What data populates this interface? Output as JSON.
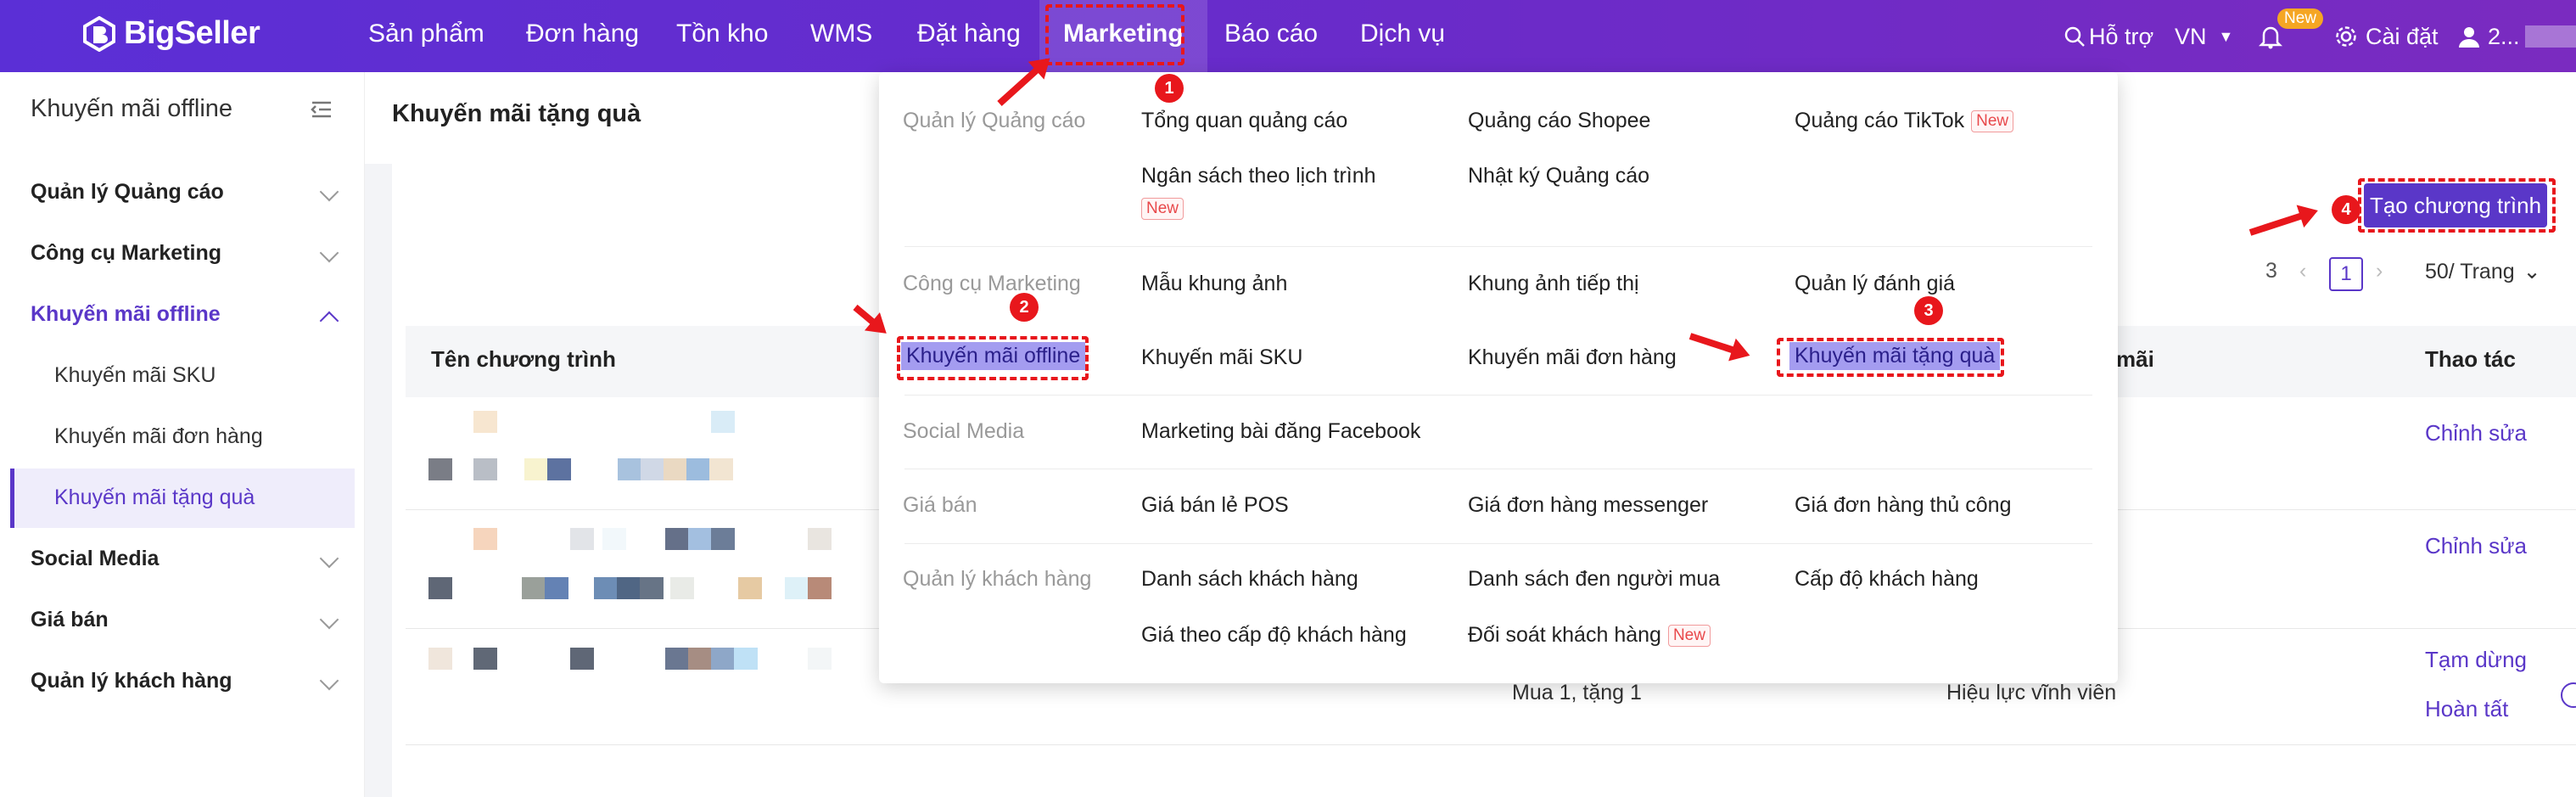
{
  "app": {
    "brand": "BigSeller"
  },
  "topnav": {
    "items": [
      "Sản phẩm",
      "Đơn hàng",
      "Tồn kho",
      "WMS",
      "Đặt hàng",
      "Marketing",
      "Báo cáo",
      "Dịch vụ"
    ],
    "active": "Marketing",
    "help": "Hỗ trợ",
    "lang": "VN",
    "new_badge": "New",
    "settings": "Cài đặt",
    "user": "2..."
  },
  "sidebar": {
    "title": "Khuyến mãi offline",
    "groups": [
      {
        "label": "Quản lý Quảng cáo"
      },
      {
        "label": "Công cụ Marketing"
      },
      {
        "label": "Khuyến mãi offline",
        "expanded": true,
        "children": [
          "Khuyến mãi SKU",
          "Khuyến mãi đơn hàng",
          "Khuyến mãi tặng quà"
        ]
      },
      {
        "label": "Social Media"
      },
      {
        "label": "Giá bán"
      },
      {
        "label": "Quản lý khách hàng"
      }
    ],
    "active_child": "Khuyến mãi tặng quà"
  },
  "page": {
    "title": "Khuyến mãi tặng quà",
    "create_button": "Tạo chương trình",
    "pager": {
      "total": "3",
      "current": "1",
      "page_size": "50/ Trang"
    },
    "columns": {
      "name": "Tên chương trình",
      "promo": "mãi",
      "actions": "Thao tác"
    },
    "rows": [
      {
        "actions": [
          "Chỉnh sửa"
        ]
      },
      {
        "actions": [
          "Chỉnh sửa"
        ]
      },
      {
        "rule": "Mua 1, tặng 1",
        "validity": "Hiệu lực vĩnh viễn",
        "actions": [
          "Tạm dừng",
          "Hoàn tất"
        ]
      }
    ]
  },
  "dropdown": {
    "sections": [
      {
        "category": "Quản lý Quảng cáo",
        "items": [
          "Tổng quan quảng cáo",
          "Quảng cáo Shopee",
          "Quảng cáo TikTok",
          "Ngân sách theo lịch trình",
          "Nhật ký Quảng cáo"
        ]
      },
      {
        "category": "Công cụ Marketing",
        "items": [
          "Mẫu khung ảnh",
          "Khung ảnh tiếp thị",
          "Quản lý đánh giá"
        ]
      },
      {
        "category": "Khuyến mãi offline",
        "items": [
          "Khuyến mãi SKU",
          "Khuyến mãi đơn hàng",
          "Khuyến mãi tặng quà"
        ]
      },
      {
        "category": "Social Media",
        "items": [
          "Marketing bài đăng Facebook"
        ]
      },
      {
        "category": "Giá bán",
        "items": [
          "Giá bán lẻ POS",
          "Giá đơn hàng messenger",
          "Giá đơn hàng thủ công"
        ]
      },
      {
        "category": "Quản lý khách hàng",
        "items": [
          "Danh sách khách hàng",
          "Danh sách đen người mua",
          "Cấp độ khách hàng",
          "Giá theo cấp độ khách hàng",
          "Đối soát khách hàng"
        ]
      }
    ],
    "new_tag": "New"
  },
  "annotations": {
    "steps": [
      "1",
      "2",
      "3",
      "4"
    ],
    "color": "#e8171c"
  },
  "colors": {
    "primary": "#5a37c8",
    "topbar": "#5b2fd6",
    "highlight": "#a49cf0"
  }
}
